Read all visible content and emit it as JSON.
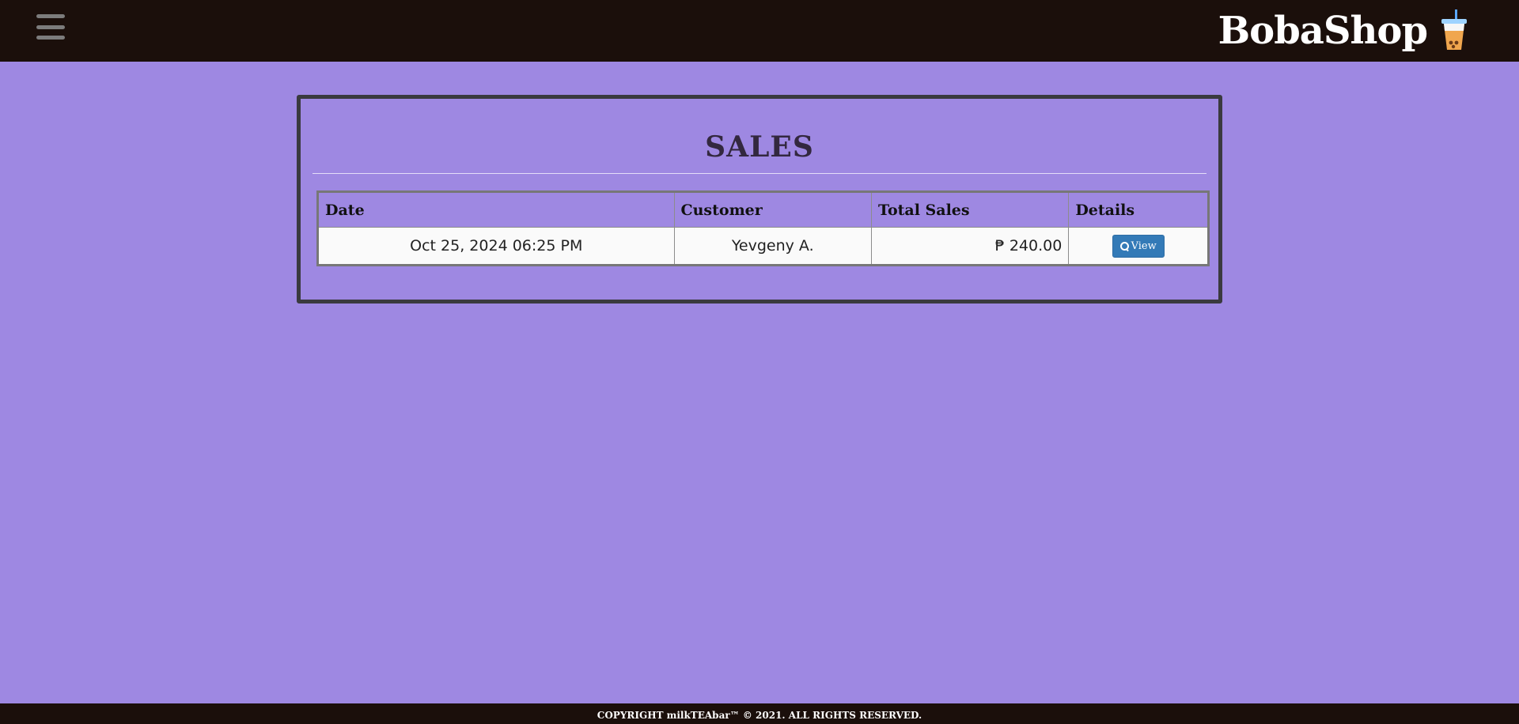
{
  "header": {
    "brand_title": "BobaShop",
    "brand_icon": "bubble-tea-cup-icon",
    "menu_icon": "hamburger-menu-icon"
  },
  "main": {
    "title": "SALES",
    "table": {
      "columns": [
        "Date",
        "Customer",
        "Total Sales",
        "Details"
      ],
      "rows": [
        {
          "date": "Oct 25, 2024 06:25 PM",
          "customer": "Yevgeny A.",
          "total_sales": "₱ 240.00",
          "details_button": "View",
          "details_icon": "search-icon"
        }
      ]
    }
  },
  "footer": {
    "text": "COPYRIGHT milkTEAbar™ © 2021. ALL RIGHTS RESERVED."
  },
  "colors": {
    "background": "#9e88e2",
    "topbar": "#1b0f0b",
    "button": "#337ab7",
    "panel_border": "#3a3a3f"
  }
}
